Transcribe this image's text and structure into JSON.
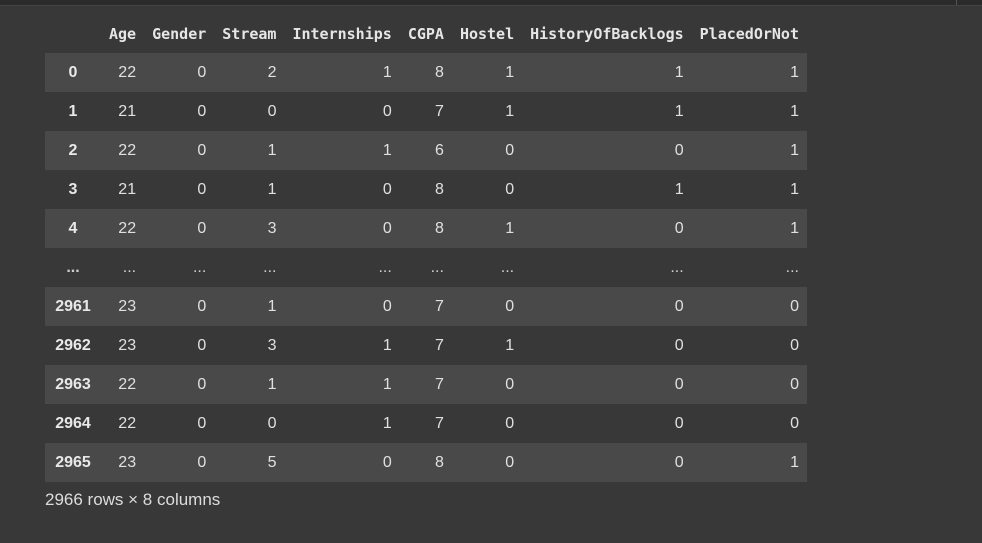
{
  "columns": [
    "",
    "Age",
    "Gender",
    "Stream",
    "Internships",
    "CGPA",
    "Hostel",
    "HistoryOfBacklogs",
    "PlacedOrNot"
  ],
  "rows": [
    {
      "index": "0",
      "cells": [
        "22",
        "0",
        "2",
        "1",
        "8",
        "1",
        "1",
        "1"
      ]
    },
    {
      "index": "1",
      "cells": [
        "21",
        "0",
        "0",
        "0",
        "7",
        "1",
        "1",
        "1"
      ]
    },
    {
      "index": "2",
      "cells": [
        "22",
        "0",
        "1",
        "1",
        "6",
        "0",
        "0",
        "1"
      ]
    },
    {
      "index": "3",
      "cells": [
        "21",
        "0",
        "1",
        "0",
        "8",
        "0",
        "1",
        "1"
      ]
    },
    {
      "index": "4",
      "cells": [
        "22",
        "0",
        "3",
        "0",
        "8",
        "1",
        "0",
        "1"
      ]
    },
    {
      "index": "...",
      "cells": [
        "...",
        "...",
        "...",
        "...",
        "...",
        "...",
        "...",
        "..."
      ]
    },
    {
      "index": "2961",
      "cells": [
        "23",
        "0",
        "1",
        "0",
        "7",
        "0",
        "0",
        "0"
      ]
    },
    {
      "index": "2962",
      "cells": [
        "23",
        "0",
        "3",
        "1",
        "7",
        "1",
        "0",
        "0"
      ]
    },
    {
      "index": "2963",
      "cells": [
        "22",
        "0",
        "1",
        "1",
        "7",
        "0",
        "0",
        "0"
      ]
    },
    {
      "index": "2964",
      "cells": [
        "22",
        "0",
        "0",
        "1",
        "7",
        "0",
        "0",
        "0"
      ]
    },
    {
      "index": "2965",
      "cells": [
        "23",
        "0",
        "5",
        "0",
        "8",
        "0",
        "0",
        "1"
      ]
    }
  ],
  "shape_text": "2966 rows × 8 columns",
  "colors": {
    "background": "#383838",
    "row_stripe": "#494949",
    "text": "#e0e0e0"
  }
}
